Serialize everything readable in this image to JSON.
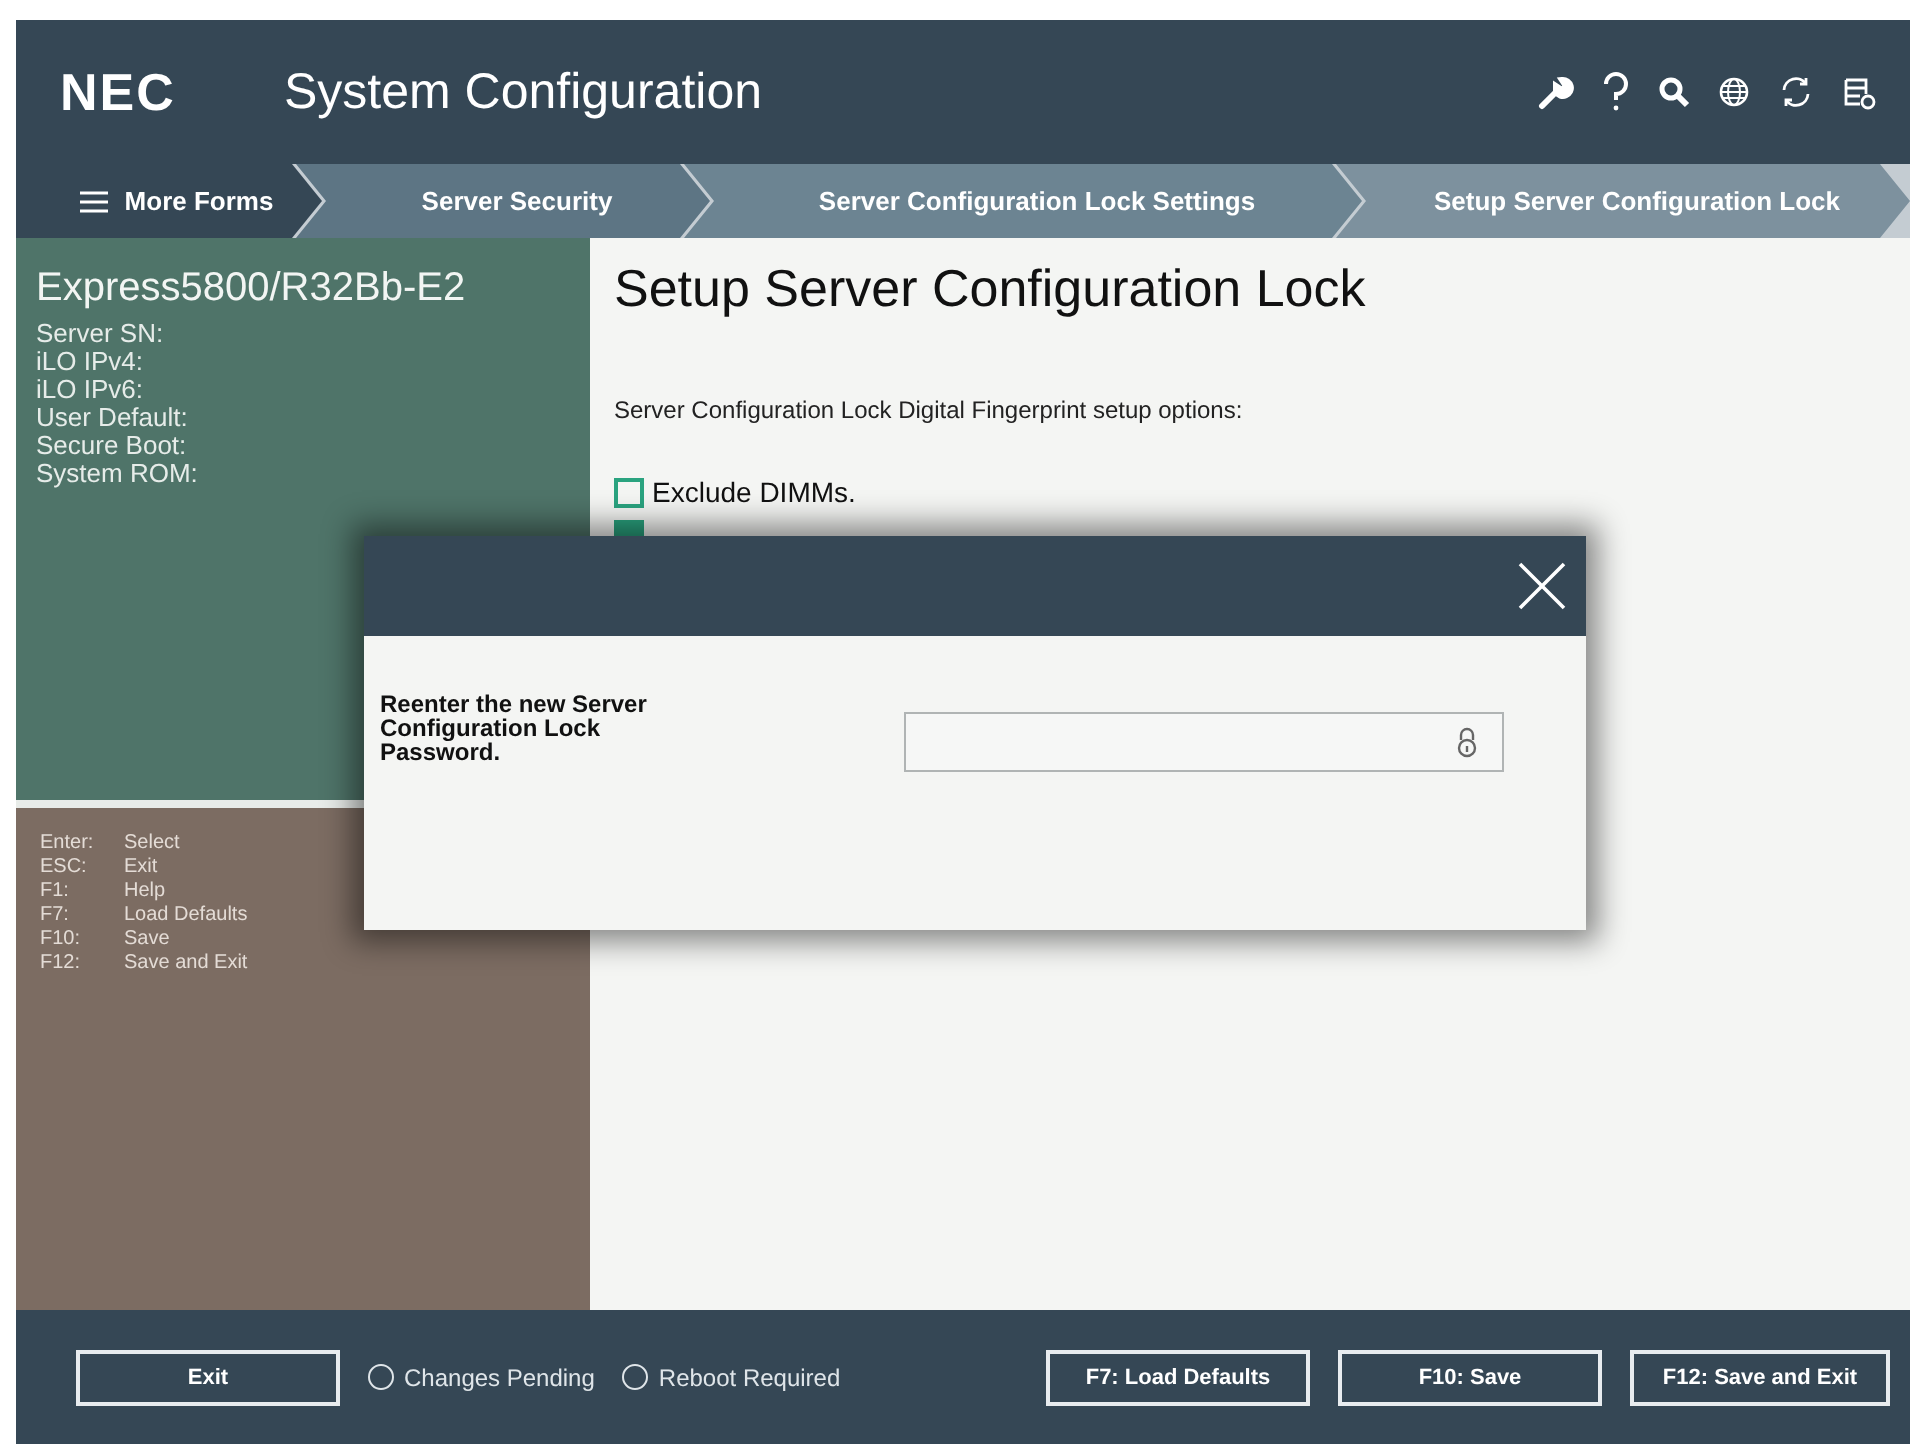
{
  "header": {
    "logo": "NEC",
    "title": "System Configuration"
  },
  "breadcrumbs": [
    {
      "label": "More Forms",
      "kind": "menu"
    },
    {
      "label": "Server Security",
      "kind": "crumb"
    },
    {
      "label": "Server Configuration Lock Settings",
      "kind": "crumb"
    },
    {
      "label": "Setup Server Configuration Lock",
      "kind": "crumb"
    }
  ],
  "system_info": {
    "model": "Express5800/R32Bb-E2",
    "fields": [
      "Server SN:",
      "iLO IPv4:",
      "iLO IPv6:",
      "User Default:",
      "Secure Boot:",
      "System ROM:"
    ]
  },
  "key_help": [
    {
      "key": "Enter:",
      "action": "Select"
    },
    {
      "key": "ESC:",
      "action": "Exit"
    },
    {
      "key": "F1:",
      "action": "Help"
    },
    {
      "key": "F7:",
      "action": "Load Defaults"
    },
    {
      "key": "F10:",
      "action": "Save"
    },
    {
      "key": "F12:",
      "action": "Save and Exit"
    }
  ],
  "page": {
    "title": "Setup Server Configuration Lock",
    "description": "Server Configuration Lock Digital Fingerprint setup options:",
    "options": [
      {
        "label": "Exclude DIMMs.",
        "checked": false
      },
      {
        "checked": true
      }
    ]
  },
  "dialog": {
    "prompt": "Reenter the new Server Configuration Lock Password."
  },
  "footer": {
    "exit": "Exit",
    "indicators": [
      {
        "label": "Changes Pending",
        "on": false
      },
      {
        "label": "Reboot Required",
        "on": false
      }
    ],
    "buttons": [
      "F7: Load Defaults",
      "F10: Save",
      "F12: Save and Exit"
    ]
  }
}
